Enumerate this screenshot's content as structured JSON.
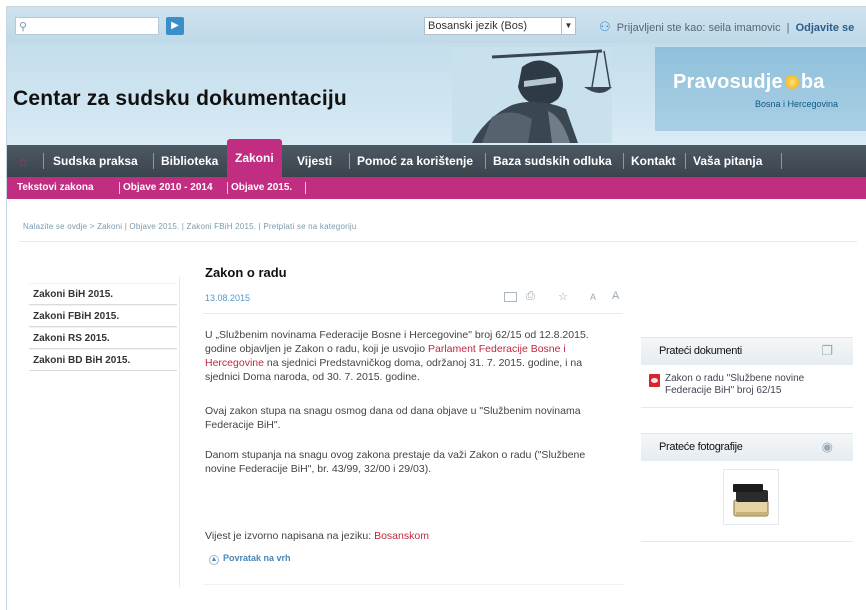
{
  "search": {
    "placeholder": "",
    "go_icon": "arrow-right-icon"
  },
  "language": {
    "selected": "Bosanski jezik (Bos)"
  },
  "login": {
    "prefix": "Prijavljeni ste kao:",
    "user": "seila imamovic",
    "logout": "Odjavite se"
  },
  "header": {
    "site_title": "Centar za sudsku dokumentaciju",
    "brand_name_left": "Pravosudje",
    "brand_name_right": "ba",
    "brand_sub": "Bosna i Hercegovina"
  },
  "main_nav": {
    "items": [
      "Sudska praksa",
      "Biblioteka",
      "Zakoni",
      "Vijesti",
      "Pomoć za korištenje",
      "Baza sudskih odluka",
      "Kontakt",
      "Vaša pitanja"
    ],
    "active": "Zakoni"
  },
  "sub_nav": {
    "items": [
      "Tekstovi zakona",
      "Objave 2010 - 2014",
      "Objave 2015."
    ]
  },
  "breadcrumb": {
    "prefix": "Nalazite se ovdje",
    "path": "Zakoni | Objave 2015. | Zakoni FBiH 2015.",
    "subscribe": "Pretplati se na kategoriju"
  },
  "left_nav": {
    "items": [
      "Zakoni BiH 2015.",
      "Zakoni FBiH 2015.",
      "Zakoni RS 2015.",
      "Zakoni BD BiH 2015."
    ]
  },
  "article": {
    "title": "Zakon o radu",
    "date": "13.08.2015",
    "p1_a": "U „Službenim novinama Federacije Bosne i Hercegovine\" broj 62/15 od 12.8.2015. godine objavljen je Zakon o radu, koji je usvojio ",
    "p1_link": "Parlament Federacije Bosne i Hercegovine",
    "p1_b": " na sjednici Predstavničkog doma, održanoj 31. 7. 2015. godine, i na sjednici Doma naroda, od 30. 7. 2015. godine.",
    "p2": "Ovaj zakon stupa na snagu osmog dana od dana objave u \"Službenim novinama Federacije BiH\".",
    "p3": "Danom stupanja na snagu ovog zakona prestaje da važi Zakon o radu (\"Službene novine Federacije BiH\", br. 43/99, 32/00 i 29/03).",
    "source_label": "Vijest je izvorno napisana na jeziku:",
    "source_lang": "Bosanskom",
    "back_to_top": "Povratak na vrh",
    "tools": {
      "font_small": "A",
      "font_large": "A"
    }
  },
  "right_panel": {
    "docs_title": "Prateći dokumenti",
    "doc_item": "Zakon o radu \"Službene novine Federacije BiH\" broj 62/15",
    "photos_title": "Prateće fotografije"
  },
  "colors": {
    "accent": "#c12d80",
    "nav_dark": "#3f4a53",
    "header_blue": "#c9e0ed",
    "link_red": "#c0283e"
  }
}
